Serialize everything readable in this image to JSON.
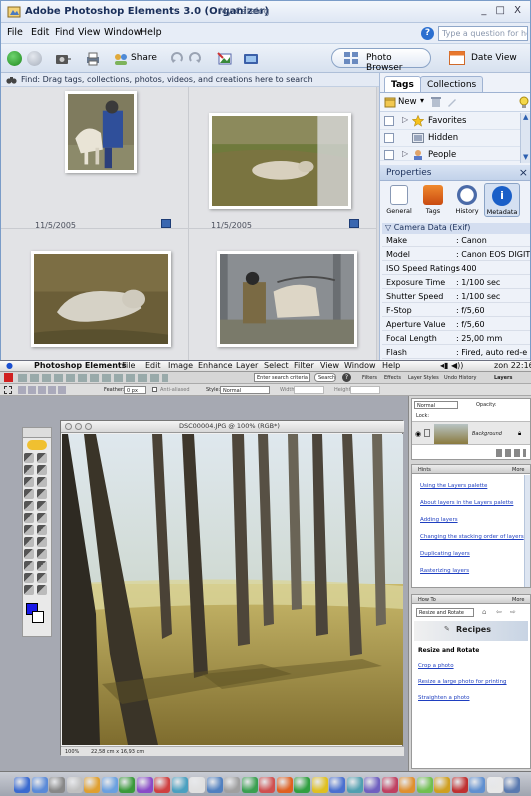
{
  "organizer": {
    "title": "Adobe Photoshop Elements 3.0 (Organizer)",
    "catalog": "My Catalog",
    "window_controls": "_ □ X",
    "menu": [
      "File",
      "Edit",
      "Find",
      "View",
      "Window",
      "Help"
    ],
    "help_placeholder": "Type a question for help",
    "toolbar": {
      "share_label": "Share",
      "photo_browser_label": "Photo Browser",
      "date_view_label": "Date View"
    },
    "find_bar": "Find: Drag tags, collections, photos, videos, and creations here to search",
    "photos": [
      {
        "date": "11/5/2005"
      },
      {
        "date": "11/5/2005"
      },
      {
        "date": ""
      },
      {
        "date": ""
      }
    ],
    "tags_panel": {
      "tabs": [
        "Tags",
        "Collections"
      ],
      "new_label": "New",
      "items": [
        "Favorites",
        "Hidden",
        "People"
      ]
    },
    "properties": {
      "title": "Properties",
      "tabs": [
        "General",
        "Tags",
        "History",
        "Metadata"
      ],
      "section": "Camera Data (Exif)",
      "rows": [
        {
          "key": "Make",
          "value": ": Canon"
        },
        {
          "key": "Model",
          "value": ": Canon EOS DIGIT"
        },
        {
          "key": "ISO Speed Ratings",
          "value": ": 400"
        },
        {
          "key": "Exposure Time",
          "value": ": 1/100 sec"
        },
        {
          "key": "Shutter Speed",
          "value": ": 1/100 sec"
        },
        {
          "key": "F-Stop",
          "value": ": f/5,60"
        },
        {
          "key": "Aperture Value",
          "value": ": f/5,60"
        },
        {
          "key": "Focal Length",
          "value": ": 25,00 mm"
        },
        {
          "key": "Flash",
          "value": ": Fired, auto red-e"
        }
      ]
    }
  },
  "editor": {
    "menu": [
      "Photoshop Elements",
      "File",
      "Edit",
      "Image",
      "Enhance",
      "Layer",
      "Select",
      "Filter",
      "View",
      "Window",
      "Help"
    ],
    "clock": "zon 22:16",
    "search_placeholder": "Enter search criteria",
    "search_button": "Search",
    "palette_tabs": [
      "Filters",
      "Effects",
      "Layer Styles",
      "Undo History",
      "Layers"
    ],
    "options": {
      "feather_label": "Feather:",
      "feather_value": "0 px",
      "anti_alias": "Anti-aliased",
      "style_label": "Style:",
      "style_value": "Normal",
      "width_label": "Width:",
      "height_label": "Height:"
    },
    "document_title": "DSC00004.JPG @ 100% (RGB*)",
    "zoom": "100%",
    "doc_size": "22,58 cm x 16,93 cm",
    "layers": {
      "blend": "Normal",
      "opacity_label": "Opacity:",
      "lock_label": "Lock:",
      "layer_name": "Background"
    },
    "help_palette": {
      "title": "Hints",
      "more": "More",
      "links": [
        "Using the Layers palette",
        "About layers in the Layers palette",
        "Adding layers",
        "Changing the stacking order of layers",
        "Duplicating layers",
        "Rasterizing layers"
      ]
    },
    "howto_palette": {
      "title": "How To",
      "more": "More",
      "select_value": "Resize and Rotate",
      "banner": "Recipes",
      "heading": "Resize and Rotate",
      "links": [
        "Crop a photo",
        "Resize a large photo for printing",
        "Straighten a photo"
      ]
    }
  },
  "colors": {
    "foreground": "#1818e8",
    "accent": "#2b6fd0"
  }
}
